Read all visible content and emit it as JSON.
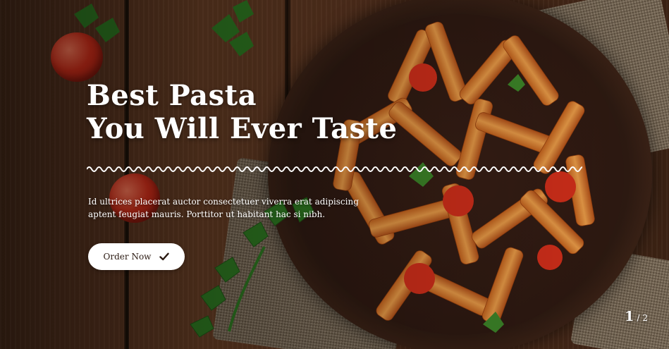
{
  "hero": {
    "title_line1": "Best Pasta",
    "title_line2": "You Will Ever Taste",
    "description": "Id ultrices placerat auctor consectetuer viverra erat adipiscing aptent feugiat mauris. Porttitor ut habitant hac si nibh.",
    "order_button_label": "Order Now",
    "order_button_icon": "check-icon"
  },
  "slider": {
    "current": "1",
    "separator": "/",
    "total": "2"
  },
  "colors": {
    "text": "#ffffff",
    "button_bg": "#ffffff",
    "button_text": "#2b1a12",
    "wood": "#5b341f",
    "tomato": "#d8301b"
  }
}
